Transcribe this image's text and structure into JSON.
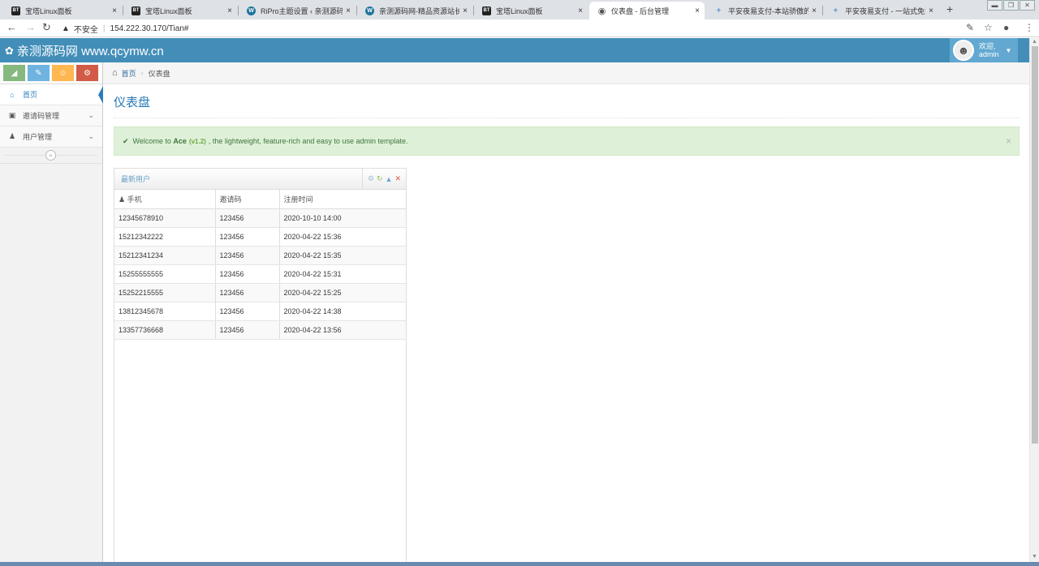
{
  "browser": {
    "tabs": [
      {
        "favicon": "BT",
        "title": "宝塔Linux面板"
      },
      {
        "favicon": "BT",
        "title": "宝塔Linux面板"
      },
      {
        "favicon": "W",
        "title": "RiPro主题设置 ‹ 亲测源码网"
      },
      {
        "favicon": "W",
        "title": "亲测源码网-精品资源站长折"
      },
      {
        "favicon": "BT",
        "title": "宝塔Linux面板"
      },
      {
        "favicon": "globe",
        "title": "仪表盘 - 后台管理"
      },
      {
        "favicon": "link",
        "title": "平安夜易支付-本站骄傲的宗"
      },
      {
        "favicon": "link",
        "title": "平安夜易支付 - 一站式免签"
      }
    ],
    "active_tab": 5,
    "close_glyph": "×",
    "new_tab_glyph": "+",
    "security_label": "不安全",
    "url": "154.222.30.170/Tian#"
  },
  "navbar": {
    "brand": "亲测源码网 www.qcymw.cn",
    "welcome": "欢迎,",
    "username": "admin"
  },
  "sidebar": {
    "items": [
      {
        "label": "首页",
        "icon": "home-icon"
      },
      {
        "label": "邀请码管理",
        "icon": "inbox-icon"
      },
      {
        "label": "用户管理",
        "icon": "user-icon"
      }
    ],
    "shortcut_colors": [
      "#87b87f",
      "#6fb3e0",
      "#ffb752",
      "#d15b47"
    ]
  },
  "breadcrumb": {
    "home": "首页",
    "current": "仪表盘"
  },
  "page": {
    "title": "仪表盘"
  },
  "alert": {
    "pre": "Welcome to",
    "product": "Ace",
    "version": "(v1.2)",
    "text": ", the lightweight, feature-rich and easy to use admin template."
  },
  "widget": {
    "title": "最新用户",
    "columns": [
      "手机",
      "邀请码",
      "注册时间"
    ],
    "rows": [
      [
        "12345678910",
        "123456",
        "2020-10-10 14:00"
      ],
      [
        "15212342222",
        "123456",
        "2020-04-22 15:36"
      ],
      [
        "15212341234",
        "123456",
        "2020-04-22 15:35"
      ],
      [
        "15255555555",
        "123456",
        "2020-04-22 15:31"
      ],
      [
        "15252215555",
        "123456",
        "2020-04-22 15:25"
      ],
      [
        "13812345678",
        "123456",
        "2020-04-22 14:38"
      ],
      [
        "13357736668",
        "123456",
        "2020-04-22 13:56"
      ]
    ]
  },
  "colors": {
    "navbar": "#438eb9",
    "accent": "#2679b5",
    "alert_bg": "#dff0d8"
  }
}
